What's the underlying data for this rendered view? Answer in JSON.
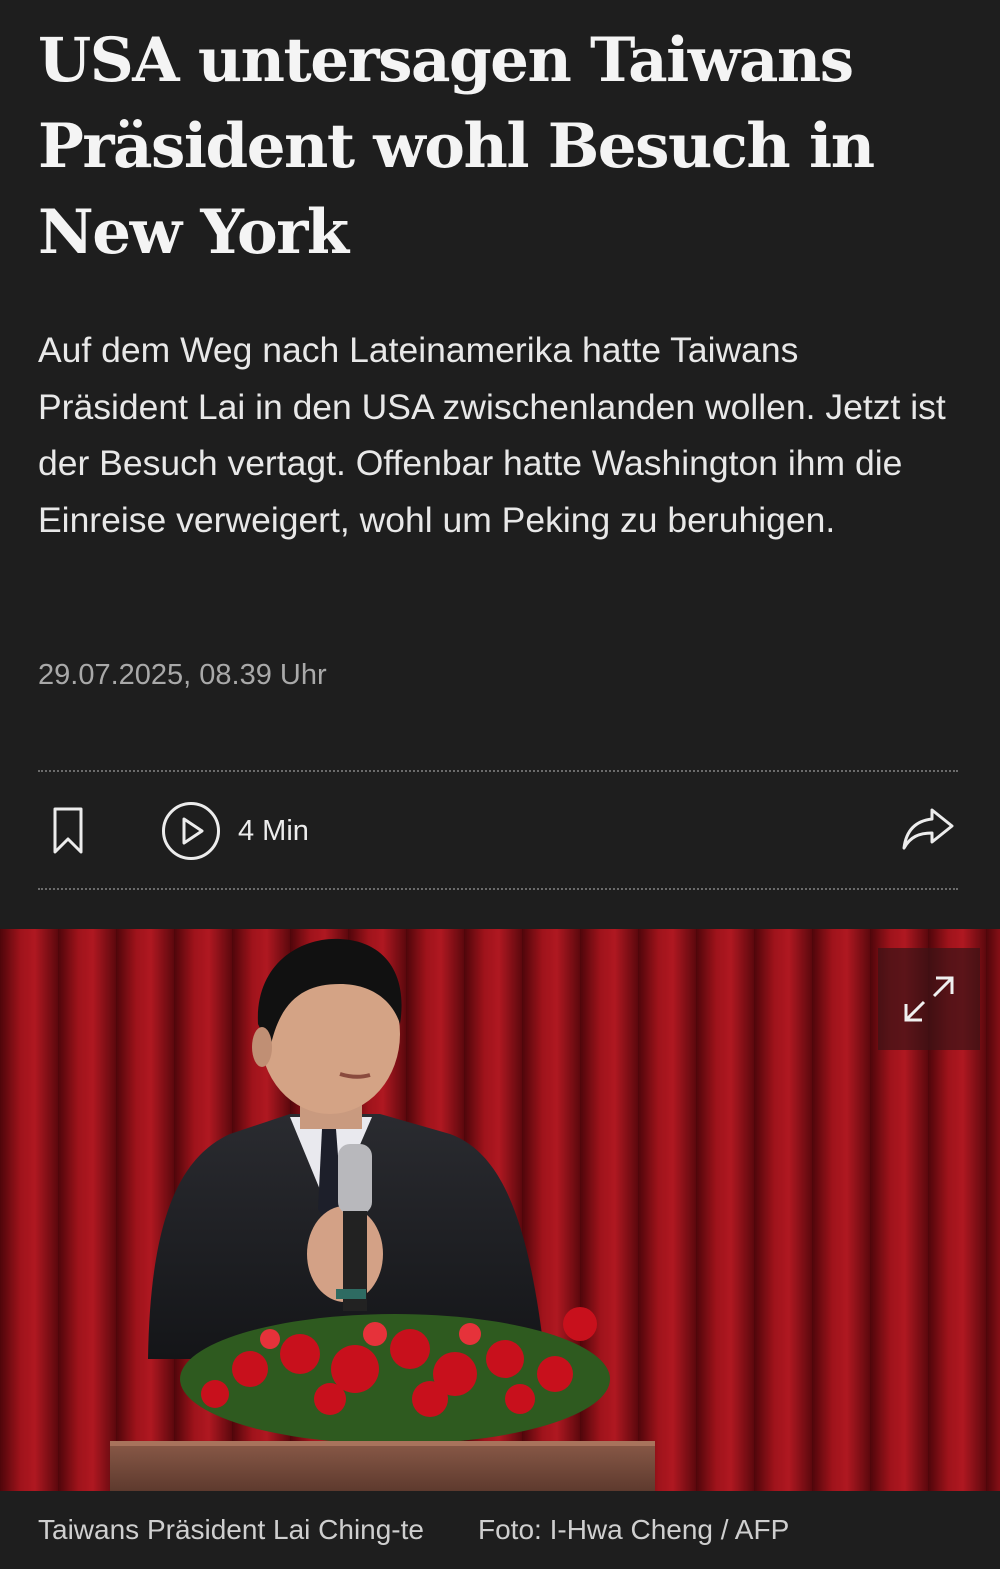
{
  "article": {
    "headline": "USA untersagen Taiwans Präsident wohl Besuch in New York",
    "lead": "Auf dem Weg nach Lateinamerika hatte Taiwans Präsident Lai in den USA zwischenlanden wollen. Jetzt ist der Besuch vertagt. Offenbar hatte Washington ihm die Einreise verweigert, wohl um Peking zu beruhigen.",
    "date": "29.07.2025, 08.39 Uhr"
  },
  "toolbar": {
    "bookmark_icon": "bookmark-icon",
    "play_icon": "play-circle-icon",
    "read_time": "4 Min",
    "share_icon": "share-arrow-icon"
  },
  "image": {
    "description_icon": "expand-icon",
    "caption": "Taiwans Präsident Lai Ching-te",
    "credit": "Foto: I-Hwa Cheng / AFP"
  },
  "colors": {
    "background": "#1e1e1e",
    "text": "#f2f2f2",
    "muted": "#a9a9a9",
    "curtain": "#a0121c"
  }
}
